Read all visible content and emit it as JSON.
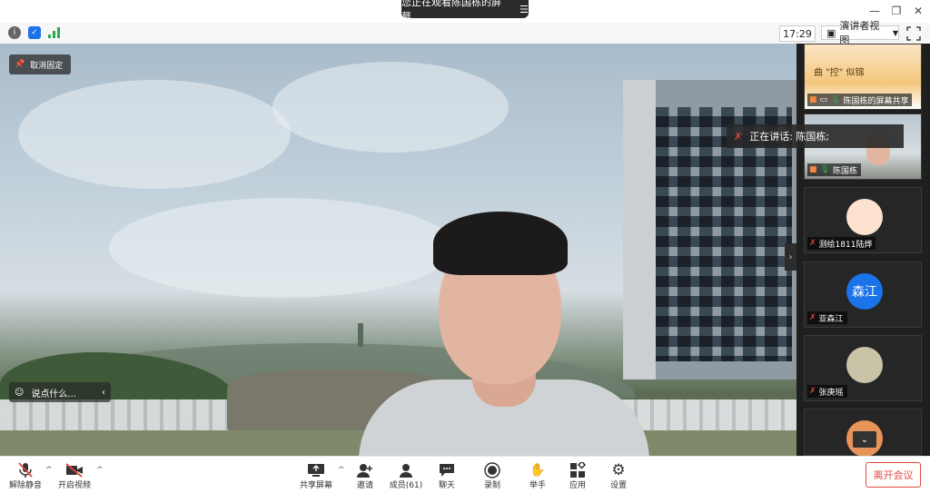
{
  "title_bar": {
    "sharing_banner": "您正在观看陈国栋的屏幕",
    "menu_icon": "hamburger-icon"
  },
  "info_bar": {
    "time": "17:29",
    "view_mode": "演讲者视图"
  },
  "video": {
    "unpin_label": "取消固定",
    "chat_placeholder": "说点什么..."
  },
  "speaking_indicator": "正在讲话: 陈国栋;",
  "sidebar": {
    "tiles": [
      {
        "name": "陈国栋的屏幕共享",
        "thumb_text": "曲 \"控\" 似锦"
      },
      {
        "name": "陈国栋"
      },
      {
        "name": "测绘1811陆烨"
      },
      {
        "name": "亚森江",
        "avatar_text": "森江"
      },
      {
        "name": "张庚瑶"
      },
      {
        "name": ""
      }
    ]
  },
  "toolbar": {
    "unmute": "解除静音",
    "start_video": "开启视频",
    "share_screen": "共享屏幕",
    "invite": "邀请",
    "members": "成员(61)",
    "chat": "聊天",
    "record": "录制",
    "raise_hand": "举手",
    "apps": "应用",
    "settings": "设置",
    "leave": "离开会议"
  },
  "colors": {
    "accent_blue": "#1a73e8",
    "leave_red": "#e04a3f",
    "mic_off_red": "#e0463b"
  }
}
